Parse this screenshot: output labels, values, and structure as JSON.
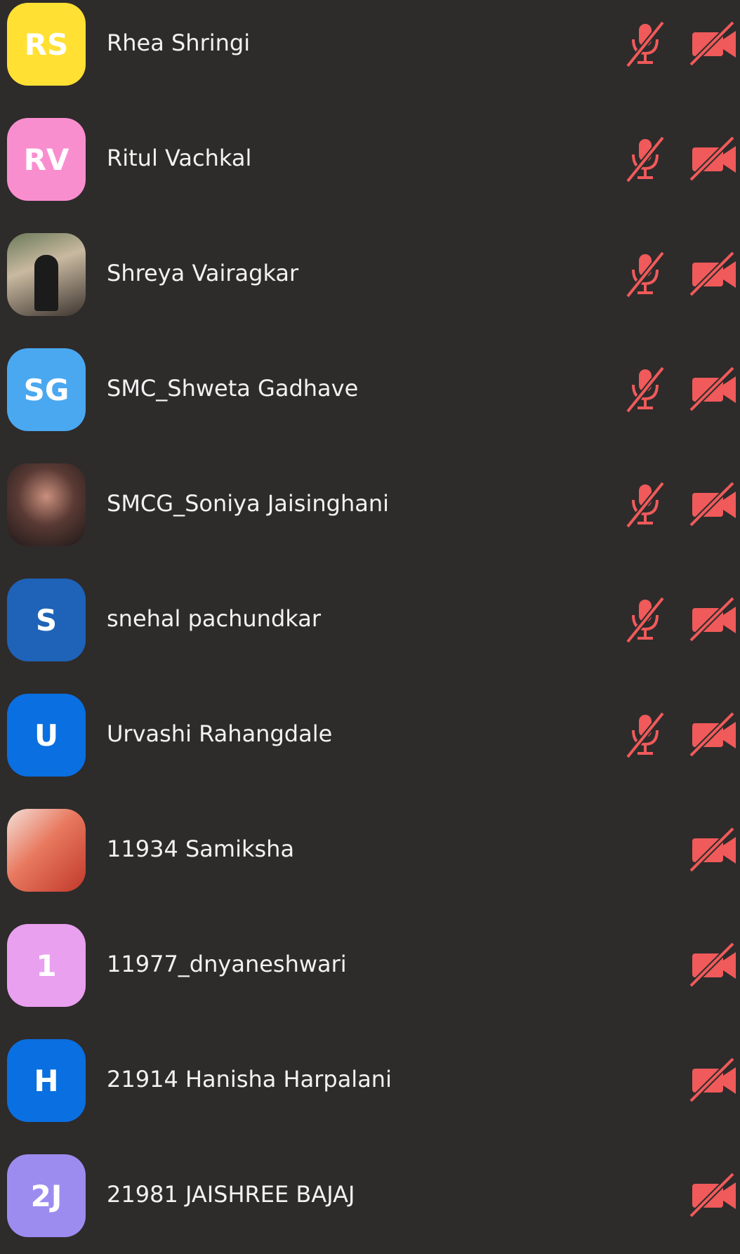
{
  "colors": {
    "background": "#2e2b2b",
    "muted_icon": "#f05a5a",
    "name_text": "#f2f2f2"
  },
  "participants": [
    {
      "initials": "RS",
      "name": "Rhea Shringi",
      "avatar_color": "#ffe033",
      "avatar_type": "initials",
      "mic_muted": true,
      "video_off": true
    },
    {
      "initials": "RV",
      "name": "Ritul Vachkal",
      "avatar_color": "#f98ecf",
      "avatar_type": "initials",
      "mic_muted": true,
      "video_off": true
    },
    {
      "initials": "",
      "name": "Shreya Vairagkar",
      "avatar_color": "",
      "avatar_type": "photo",
      "mic_muted": true,
      "video_off": true
    },
    {
      "initials": "SG",
      "name": "SMC_Shweta Gadhave",
      "avatar_color": "#4aa8f0",
      "avatar_type": "initials",
      "mic_muted": true,
      "video_off": true
    },
    {
      "initials": "",
      "name": "SMCG_Soniya Jaisinghani",
      "avatar_color": "",
      "avatar_type": "photo-dark",
      "mic_muted": true,
      "video_off": true
    },
    {
      "initials": "S",
      "name": "snehal pachundkar",
      "avatar_color": "#1e63b8",
      "avatar_type": "initials",
      "mic_muted": true,
      "video_off": true
    },
    {
      "initials": "U",
      "name": "Urvashi Rahangdale",
      "avatar_color": "#0a6fe0",
      "avatar_type": "initials",
      "mic_muted": true,
      "video_off": true
    },
    {
      "initials": "",
      "name": "11934 Samiksha",
      "avatar_color": "",
      "avatar_type": "photo-red",
      "mic_muted": false,
      "video_off": true
    },
    {
      "initials": "1",
      "name": "11977_dnyaneshwari",
      "avatar_color": "#e9a0ef",
      "avatar_type": "initials",
      "mic_muted": false,
      "video_off": true
    },
    {
      "initials": "H",
      "name": "21914 Hanisha Harpalani",
      "avatar_color": "#0a6fe0",
      "avatar_type": "initials",
      "mic_muted": false,
      "video_off": true
    },
    {
      "initials": "2J",
      "name": "21981 JAISHREE BAJAJ",
      "avatar_color": "#9d8cf0",
      "avatar_type": "initials",
      "mic_muted": false,
      "video_off": true
    }
  ]
}
